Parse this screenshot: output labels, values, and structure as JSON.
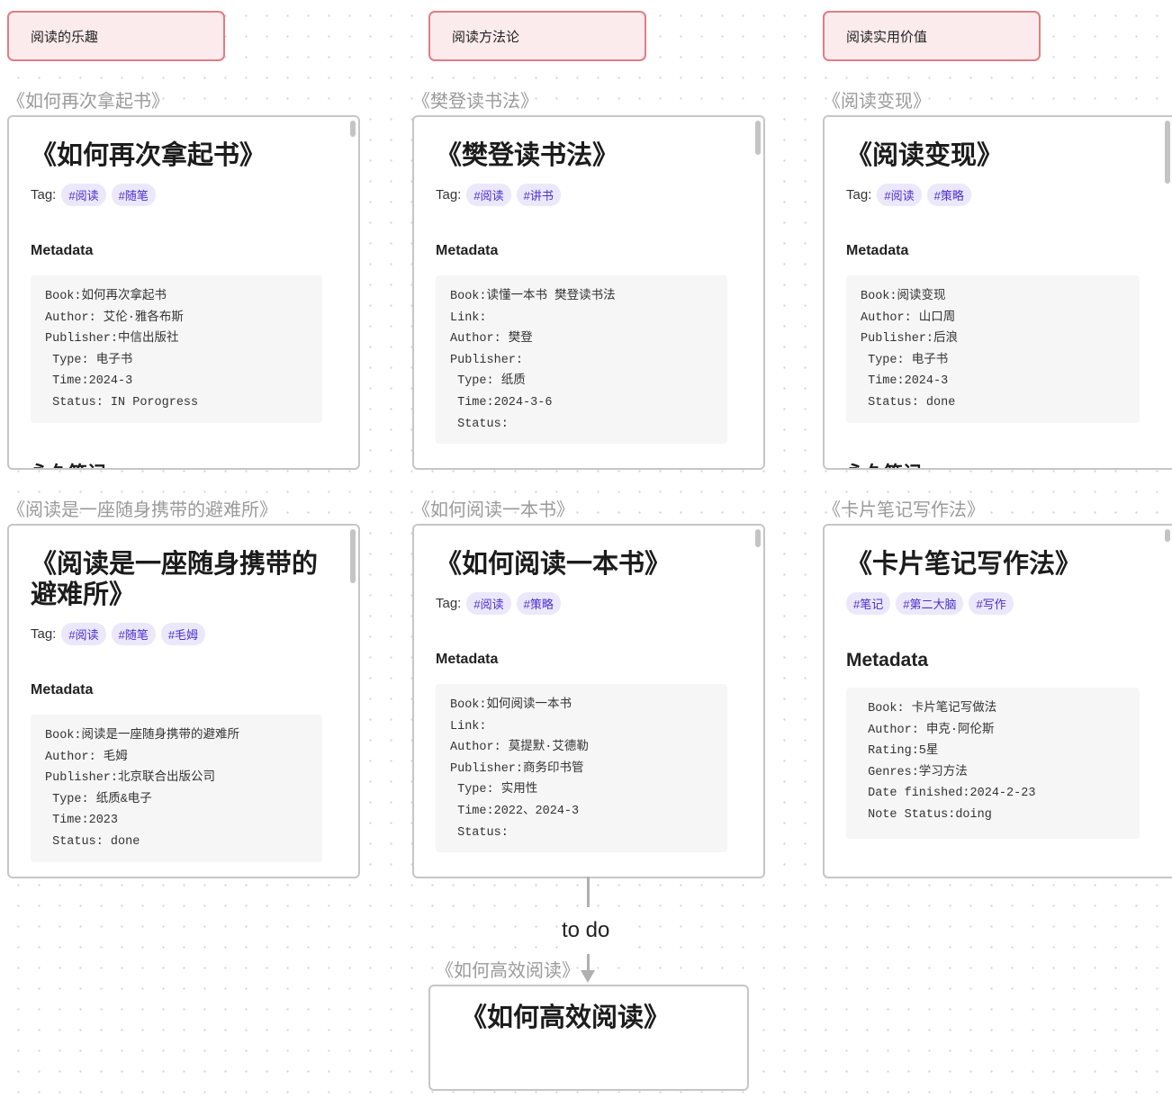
{
  "groups": [
    {
      "label": "阅读的乐趣"
    },
    {
      "label": "阅读方法论"
    },
    {
      "label": "阅读实用价值"
    }
  ],
  "cards": [
    {
      "file_label": "《如何再次拿起书》",
      "title": "《如何再次拿起书》",
      "tag_prefix": "Tag:",
      "tags": [
        "#阅读",
        "#随笔"
      ],
      "meta_heading": "Metadata",
      "meta_lines": [
        "Book:如何再次拿起书",
        "Author: 艾伦·雅各布斯",
        "Publisher:中信出版社",
        " Type: 电子书",
        " Time:2024-3",
        " Status: IN Porogress"
      ],
      "overflow_heading": "永久笔记"
    },
    {
      "file_label": "《樊登读书法》",
      "title": "《樊登读书法》",
      "tag_prefix": "Tag:",
      "tags": [
        "#阅读",
        "#讲书"
      ],
      "meta_heading": "Metadata",
      "meta_lines": [
        "Book:读懂一本书 樊登读书法",
        "Link:",
        "Author: 樊登",
        "Publisher:",
        " Type: 纸质",
        " Time:2024-3-6",
        " Status:"
      ],
      "overflow_heading": ""
    },
    {
      "file_label": "《阅读变现》",
      "title": "《阅读变现》",
      "tag_prefix": "Tag:",
      "tags": [
        "#阅读",
        "#策略"
      ],
      "meta_heading": "Metadata",
      "meta_lines": [
        "Book:阅读变现",
        "Author: 山口周",
        "Publisher:后浪",
        " Type: 电子书",
        " Time:2024-3",
        " Status: done"
      ],
      "overflow_heading": "永久笔记"
    },
    {
      "file_label": "《阅读是一座随身携带的避难所》",
      "title": "《阅读是一座随身携带的避难所》",
      "tag_prefix": "Tag:",
      "tags": [
        "#阅读",
        "#随笔",
        "#毛姆"
      ],
      "meta_heading": "Metadata",
      "meta_lines": [
        "Book:阅读是一座随身携带的避难所",
        "Author: 毛姆",
        "Publisher:北京联合出版公司",
        " Type: 纸质&电子",
        " Time:2023",
        " Status: done"
      ],
      "overflow_heading": ""
    },
    {
      "file_label": "《如何阅读一本书》",
      "title": "《如何阅读一本书》",
      "tag_prefix": "Tag:",
      "tags": [
        "#阅读",
        "#策略"
      ],
      "meta_heading": "Metadata",
      "meta_lines": [
        "Book:如何阅读一本书",
        "Link:",
        "Author: 莫提默·艾德勒",
        "Publisher:商务印书管",
        " Type: 实用性",
        " Time:2022、2024-3",
        " Status:"
      ],
      "overflow_heading": ""
    },
    {
      "file_label": "《卡片笔记写作法》",
      "title": "《卡片笔记写作法》",
      "tag_prefix": "",
      "tags": [
        "#笔记",
        "#第二大脑",
        "#写作"
      ],
      "meta_heading": "Metadata",
      "meta_lines": [
        " Book: 卡片笔记写做法",
        " Author: 申克·阿伦斯",
        " Rating:5星",
        " Genres:学习方法",
        " Date finished:2024-2-23",
        " Note Status:doing"
      ],
      "overflow_heading": ""
    },
    {
      "file_label": "《如何高效阅读》",
      "title": "《如何高效阅读》"
    }
  ],
  "edge": {
    "label": "to do"
  }
}
